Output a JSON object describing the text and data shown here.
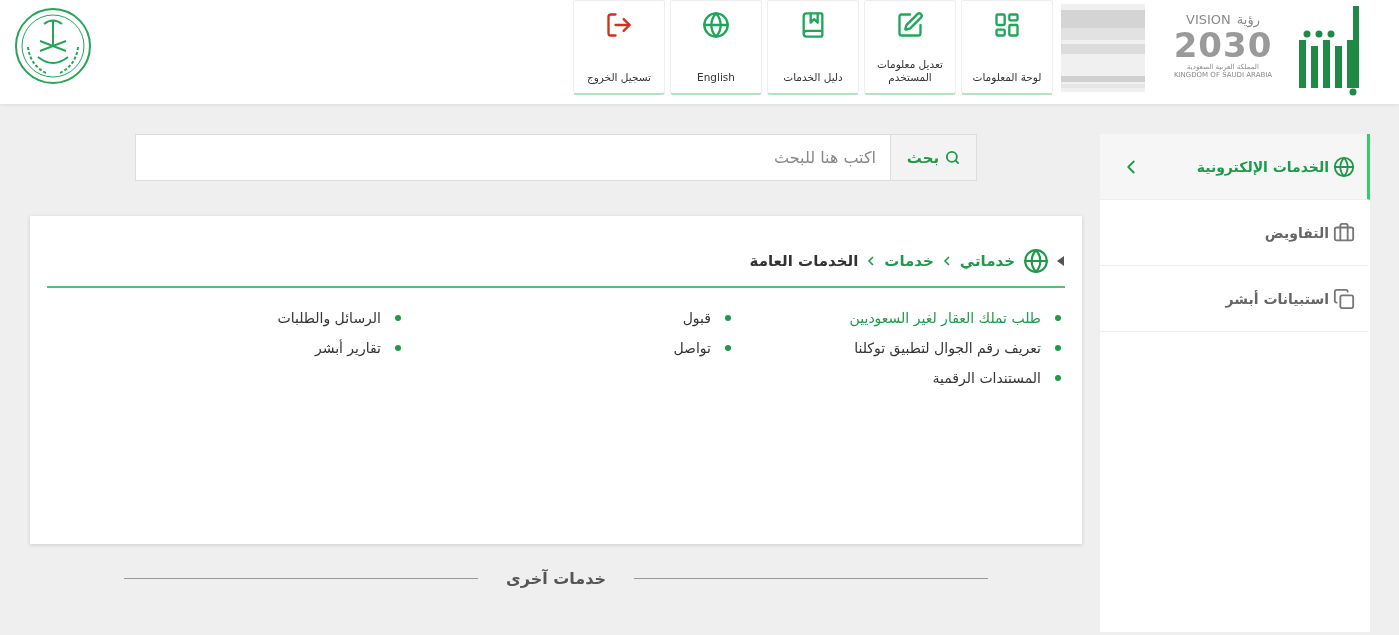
{
  "header": {
    "vision_logo": {
      "arabic": "رؤية",
      "latin": "VISION",
      "year": "2030",
      "arabic_country": "المملكة العربية السعودية",
      "latin_country": "KINGDOM OF SAUDI ARABIA"
    },
    "nav": [
      {
        "kind": "dashboard",
        "label": "لوحة المعلومات"
      },
      {
        "kind": "edit",
        "label": "تعديل معلومات المستخدم"
      },
      {
        "kind": "guide",
        "label": "دليل الخدمات"
      },
      {
        "kind": "language",
        "label": "English"
      },
      {
        "kind": "logout",
        "label": "تسجيل الخروج"
      }
    ]
  },
  "sidebar": {
    "items": [
      {
        "label": "الخدمات الإلكترونية",
        "kind": "services",
        "selected": true
      },
      {
        "label": "التفاويض",
        "kind": "delegations",
        "selected": false
      },
      {
        "label": "استبيانات أبشر",
        "kind": "surveys",
        "selected": false
      }
    ]
  },
  "search": {
    "button": "بحث",
    "placeholder": "اكتب هنا للبحث"
  },
  "breadcrumb": [
    {
      "label": "خدماتي",
      "kind": "link"
    },
    {
      "label": "خدمات",
      "kind": "link"
    },
    {
      "label": "الخدمات العامة",
      "kind": "current"
    }
  ],
  "services": [
    [
      {
        "label": "طلب تملك العقار لغير السعوديين",
        "highlighted": true
      },
      {
        "label": "تعريف رقم الجوال لتطبيق توكلنا",
        "highlighted": false
      },
      {
        "label": "المستندات الرقمية",
        "highlighted": false
      }
    ],
    [
      {
        "label": "قبول",
        "highlighted": false
      },
      {
        "label": "تواصل",
        "highlighted": false
      }
    ],
    [
      {
        "label": "الرسائل والطلبات",
        "highlighted": false
      },
      {
        "label": "تقارير أبشر",
        "highlighted": false
      }
    ]
  ],
  "other_services": {
    "title": "خدمات آخرى"
  }
}
